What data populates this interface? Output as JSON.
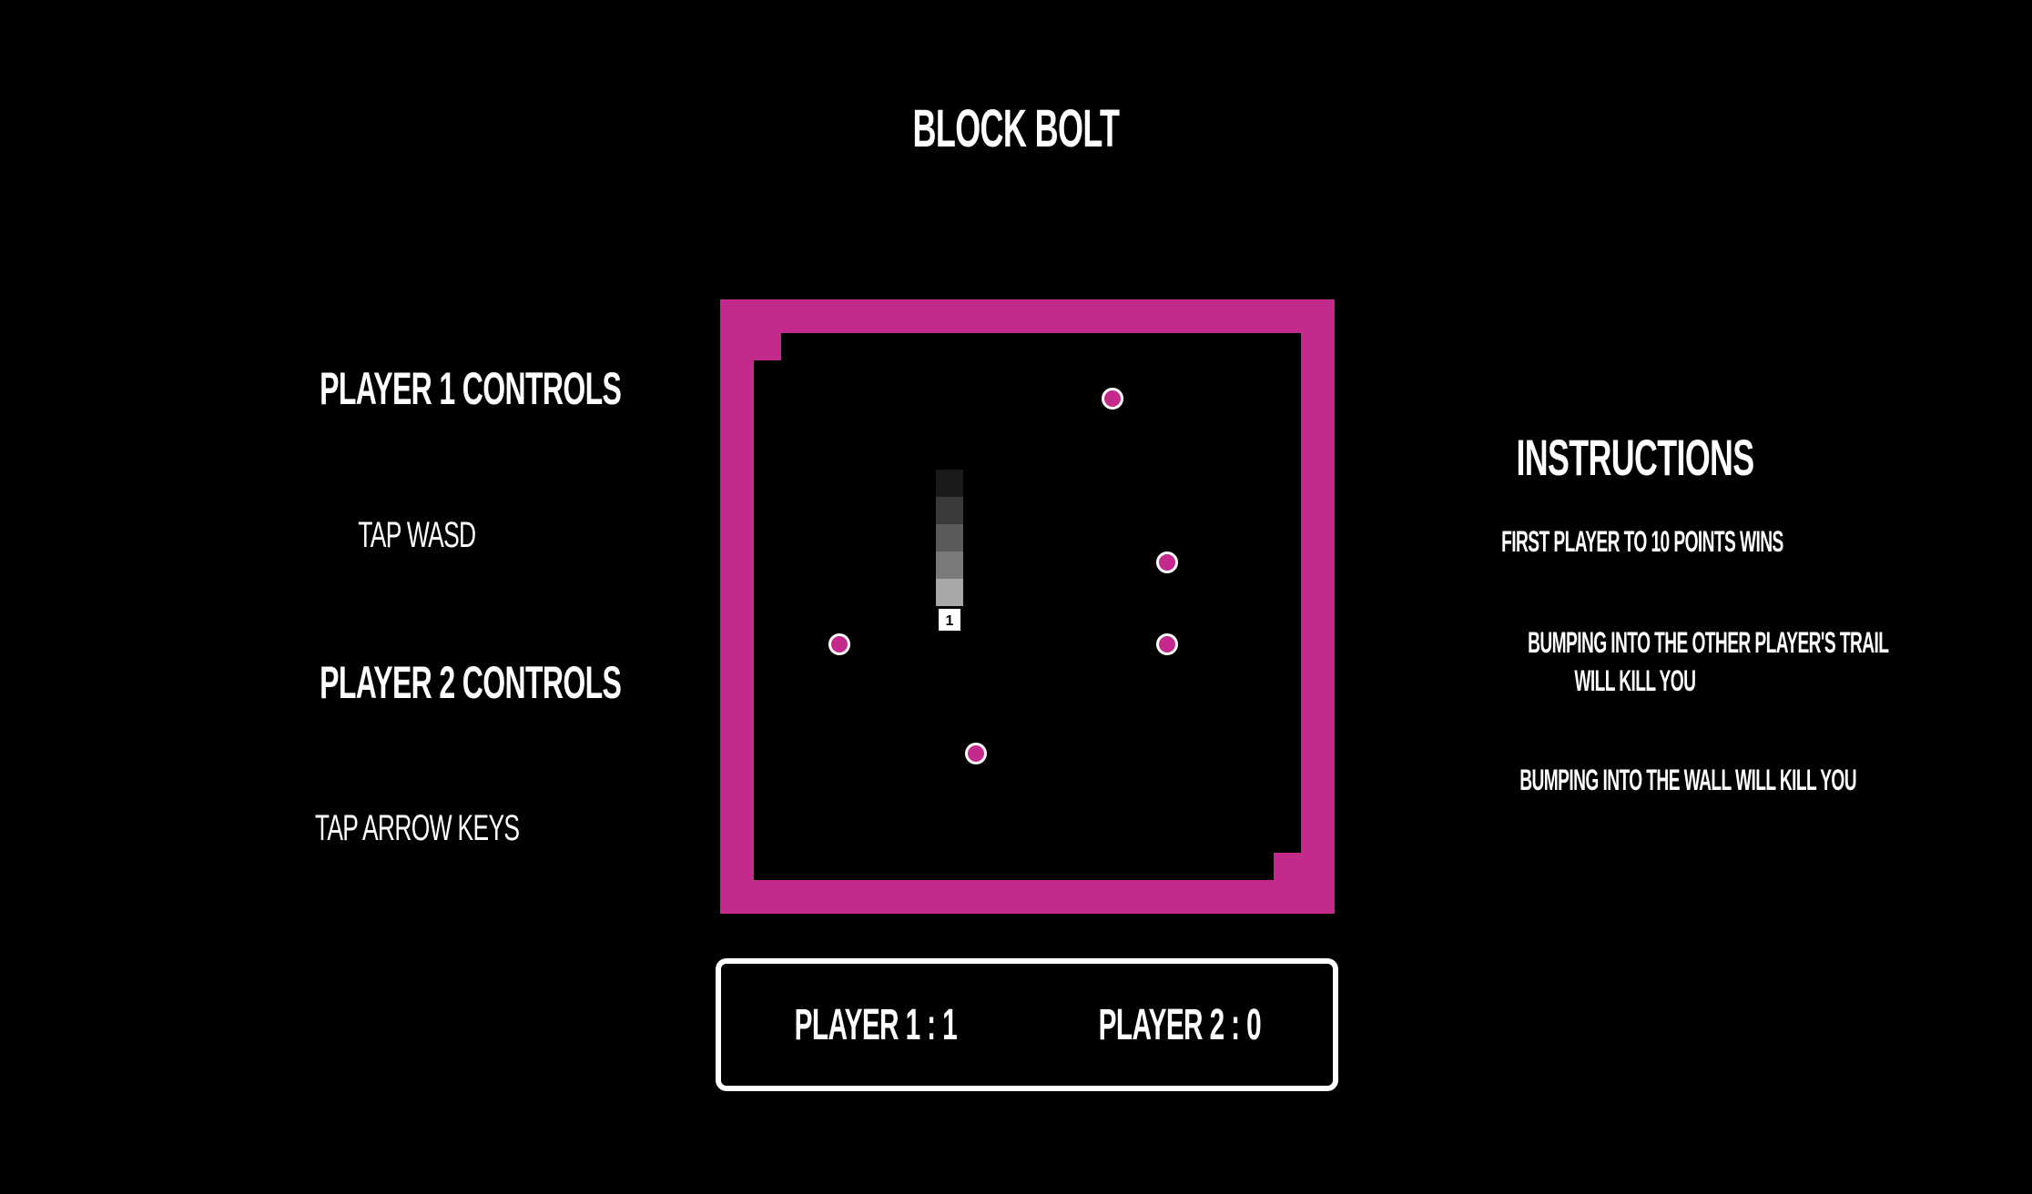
{
  "game": {
    "title": "BLOCK BOLT"
  },
  "controls": {
    "player1_heading": "PLAYER 1 CONTROLS",
    "player1_keys": "TAP WASD",
    "player2_heading": "PLAYER 2 CONTROLS",
    "player2_keys": "TAP ARROW KEYS"
  },
  "instructions": {
    "heading": "INSTRUCTIONS",
    "lines": [
      "FIRST PLAYER TO 10 POINTS WINS",
      "BUMPING INTO THE OTHER PLAYER'S TRAIL",
      "WILL KILL YOU",
      "BUMPING INTO THE WALL WILL KILL YOU"
    ]
  },
  "board": {
    "wall_color": "#c42a8c",
    "pellet_color": "#c42a8c",
    "pellet_count": 5,
    "player_marker_label": "1",
    "trail_shades": [
      "#1a1a1a",
      "#3a3a3a",
      "#5a5a5a",
      "#7a7a7a",
      "#a8a8a8"
    ]
  },
  "scoreboard": {
    "player1": "PLAYER 1 : 1",
    "player2": "PLAYER 2 : 0"
  }
}
